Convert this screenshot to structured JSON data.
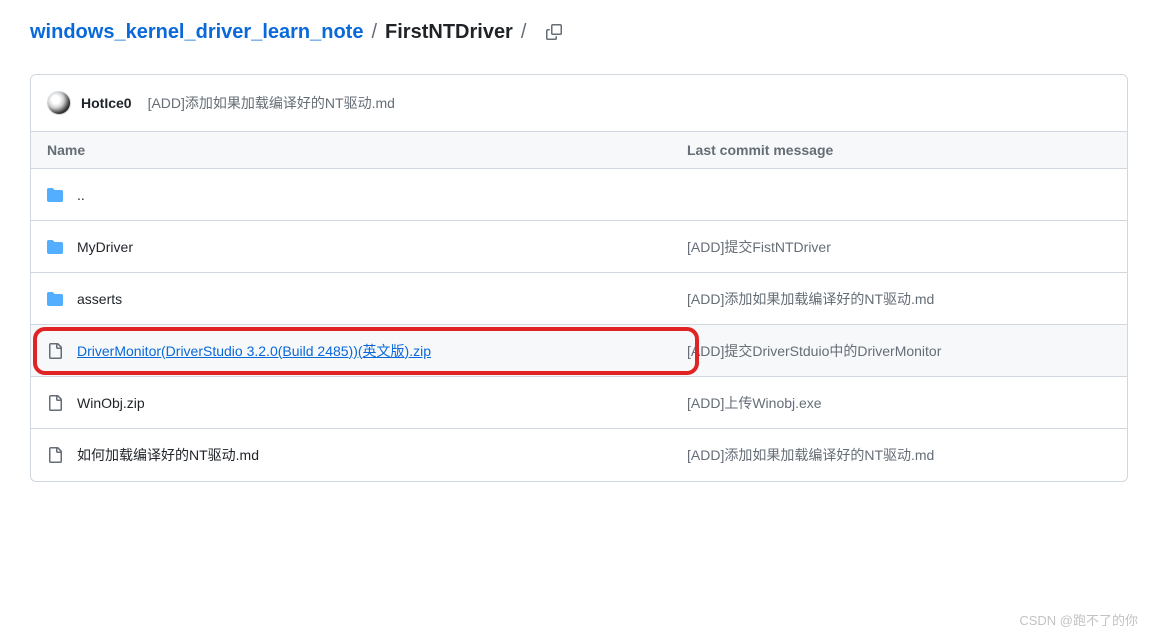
{
  "breadcrumb": {
    "repo": "windows_kernel_driver_learn_note",
    "current": "FirstNTDriver",
    "sep": "/"
  },
  "commit": {
    "author": "HotIce0",
    "message": "[ADD]添加如果加载编译好的NT驱动.md"
  },
  "table": {
    "headers": {
      "name": "Name",
      "lastCommit": "Last commit message"
    },
    "parent": "..",
    "rows": [
      {
        "type": "folder",
        "name": "MyDriver",
        "msg": "[ADD]提交FistNTDriver",
        "highlighted": false,
        "linked": false
      },
      {
        "type": "folder",
        "name": "asserts",
        "msg": "[ADD]添加如果加载编译好的NT驱动.md",
        "highlighted": false,
        "linked": false
      },
      {
        "type": "file",
        "name": "DriverMonitor(DriverStudio 3.2.0(Build 2485))(英文版).zip",
        "msg": "[ADD]提交DriverStduio中的DriverMonitor",
        "highlighted": true,
        "linked": true
      },
      {
        "type": "file",
        "name": "WinObj.zip",
        "msg": "[ADD]上传Winobj.exe",
        "highlighted": false,
        "linked": false
      },
      {
        "type": "file",
        "name": "如何加载编译好的NT驱动.md",
        "msg": "[ADD]添加如果加载编译好的NT驱动.md",
        "highlighted": false,
        "linked": false
      }
    ]
  },
  "watermark": "CSDN @跑不了的你"
}
